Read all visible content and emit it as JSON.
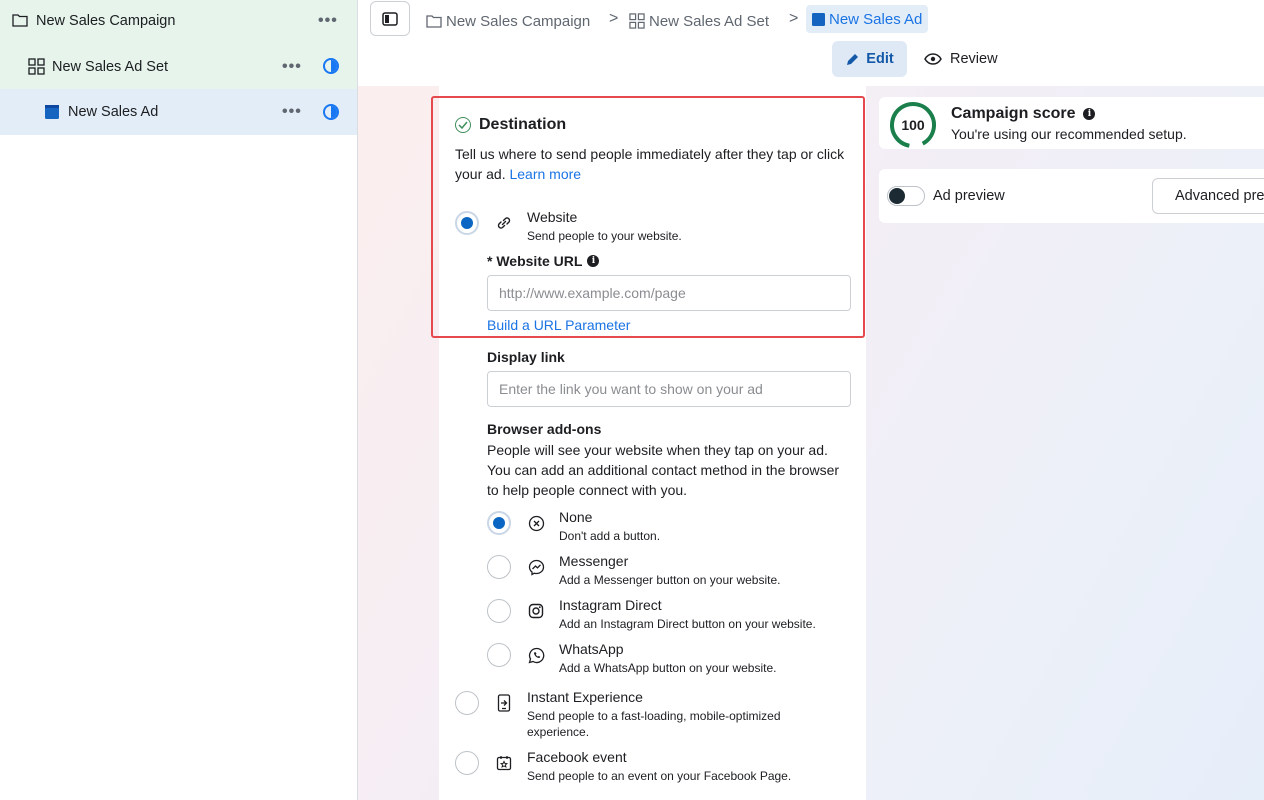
{
  "sidebar": {
    "campaign": "New Sales Campaign",
    "adset": "New Sales Ad Set",
    "ad": "New Sales Ad",
    "more": "•••"
  },
  "breadcrumb": {
    "campaign": "New Sales Campaign",
    "adset": "New Sales Ad Set",
    "ad": "New Sales Ad",
    "sep": ">"
  },
  "tabs": {
    "edit": "Edit",
    "review": "Review"
  },
  "destination": {
    "title": "Destination",
    "description": "Tell us where to send people immediately after they tap or click your ad.",
    "learn_more": "Learn more",
    "website": {
      "title": "Website",
      "sub": "Send people to your website."
    },
    "url_label": "* Website URL",
    "url_placeholder": "http://www.example.com/page",
    "url_value": "",
    "build_param": "Build a URL Parameter",
    "display_link_label": "Display link",
    "display_link_placeholder": "Enter the link you want to show on your ad",
    "addons_title": "Browser add-ons",
    "addons_desc": "People will see your website when they tap on your ad. You can add an additional contact method in the browser to help people connect with you.",
    "addons": [
      {
        "title": "None",
        "sub": "Don't add a button."
      },
      {
        "title": "Messenger",
        "sub": "Add a Messenger button on your website."
      },
      {
        "title": "Instagram Direct",
        "sub": "Add an Instagram Direct button on your website."
      },
      {
        "title": "WhatsApp",
        "sub": "Add a WhatsApp button on your website."
      }
    ],
    "instant": {
      "title": "Instant Experience",
      "sub": "Send people to a fast-loading, mobile-optimized experience."
    },
    "event": {
      "title": "Facebook event",
      "sub": "Send people to an event on your Facebook Page."
    }
  },
  "score": {
    "value": "100",
    "title": "Campaign score",
    "sub": "You're using our recommended setup."
  },
  "preview": {
    "label": "Ad preview",
    "advanced": "Advanced preview"
  },
  "colors": {
    "accent": "#1b74e4",
    "score_ring": "#1a7f4b",
    "highlight": "#e5484d"
  }
}
